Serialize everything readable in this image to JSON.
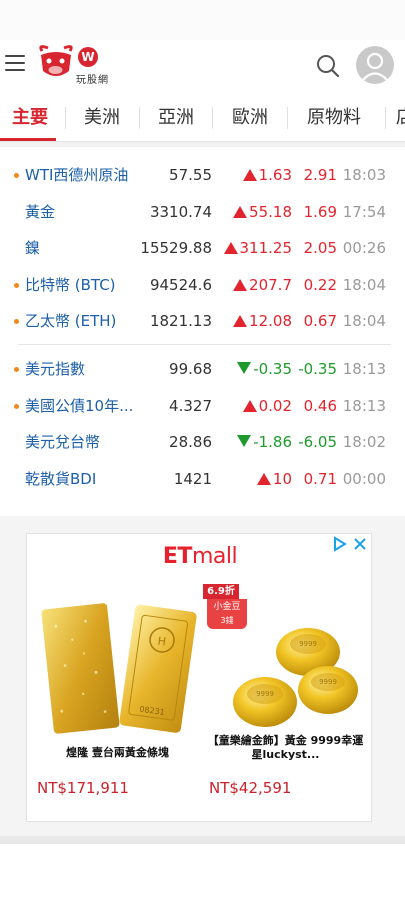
{
  "header": {
    "logo_text": "玩股網",
    "brand_color": "#d7262f"
  },
  "tabs": [
    {
      "label": "主要",
      "active": true
    },
    {
      "label": "美洲",
      "active": false
    },
    {
      "label": "亞洲",
      "active": false
    },
    {
      "label": "歐洲",
      "active": false
    },
    {
      "label": "原物料",
      "active": false
    },
    {
      "label": "店",
      "active": false
    }
  ],
  "quotes": {
    "group1": [
      {
        "name": "WTI西德州原油",
        "price": "57.55",
        "change": "1.63",
        "pct": "2.91",
        "time": "18:03",
        "dir": "up",
        "dot": true
      },
      {
        "name": "黃金",
        "price": "3310.74",
        "change": "55.18",
        "pct": "1.69",
        "time": "17:54",
        "dir": "up",
        "dot": false
      },
      {
        "name": "鎳",
        "price": "15529.88",
        "change": "311.25",
        "pct": "2.05",
        "time": "00:26",
        "dir": "up",
        "dot": false
      },
      {
        "name": "比特幣 (BTC)",
        "price": "94524.6",
        "change": "207.7",
        "pct": "0.22",
        "time": "18:04",
        "dir": "up",
        "dot": true
      },
      {
        "name": "乙太幣 (ETH)",
        "price": "1821.13",
        "change": "12.08",
        "pct": "0.67",
        "time": "18:04",
        "dir": "up",
        "dot": true
      }
    ],
    "group2": [
      {
        "name": "美元指數",
        "price": "99.68",
        "change": "-0.35",
        "pct": "-0.35",
        "time": "18:13",
        "dir": "down",
        "dot": true
      },
      {
        "name": "美國公債10年...",
        "price": "4.327",
        "change": "0.02",
        "pct": "0.46",
        "time": "18:13",
        "dir": "up",
        "dot": true
      },
      {
        "name": "美元兌台幣",
        "price": "28.86",
        "change": "-1.86",
        "pct": "-6.05",
        "time": "18:02",
        "dir": "down",
        "dot": false
      },
      {
        "name": "乾散貨BDI",
        "price": "1421",
        "change": "10",
        "pct": "0.71",
        "time": "00:00",
        "dir": "up",
        "dot": false
      }
    ]
  },
  "ad": {
    "brand_et": "ET",
    "brand_mall": "mall",
    "promo_discount": "6.9折",
    "promo_item": "小金豆",
    "promo_qty": "3錢",
    "products": [
      {
        "name": "煌隆 壹台兩黃金條塊",
        "price": "NT$171,911"
      },
      {
        "name": "【童樂繪金飾】黃金 9999幸運星luckyst...",
        "price": "NT$42,591"
      }
    ]
  },
  "colors": {
    "up": "#e2242e",
    "down": "#1e9a2e",
    "link": "#1d5fa8",
    "dot": "#f08a1c"
  }
}
